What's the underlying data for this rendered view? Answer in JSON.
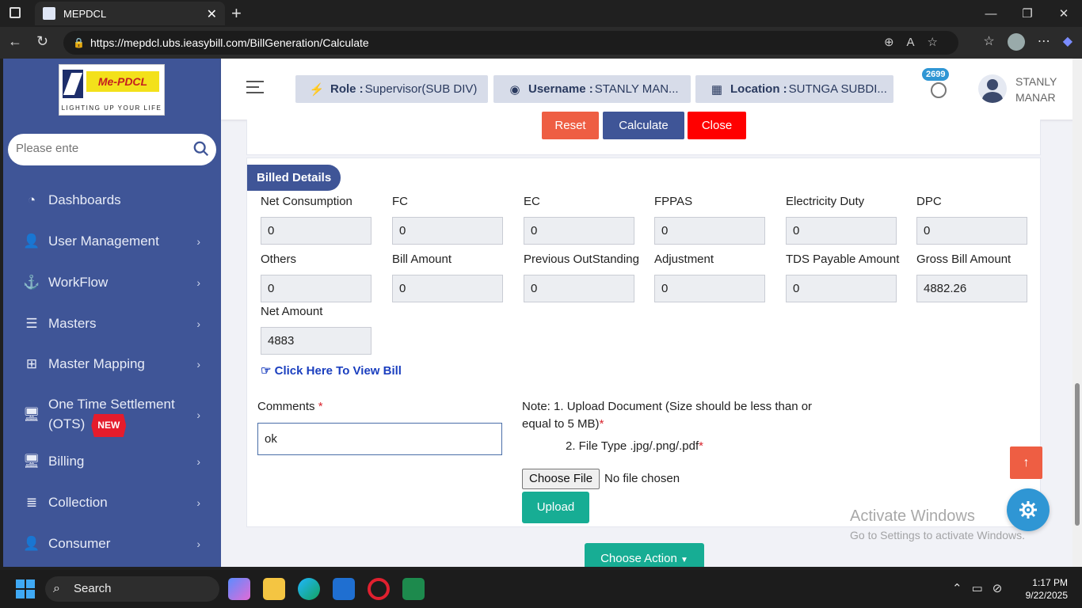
{
  "browser": {
    "tab_title": "MEPDCL",
    "url": "https://mepdcl.ubs.ieasybill.com/BillGeneration/Calculate"
  },
  "logo": {
    "brand": "Me-PDCL",
    "tagline": "LIGHTING UP YOUR LIFE"
  },
  "sidebar": {
    "search_placeholder": "Please ente",
    "items": [
      {
        "label": "Dashboards",
        "icon": "dashboard-icon",
        "has_chevron": false
      },
      {
        "label": "User Management",
        "icon": "user-icon",
        "has_chevron": true
      },
      {
        "label": "WorkFlow",
        "icon": "anchor-icon",
        "has_chevron": true
      },
      {
        "label": "Masters",
        "icon": "server-icon",
        "has_chevron": true
      },
      {
        "label": "Master Mapping",
        "icon": "sitemap-icon",
        "has_chevron": true
      },
      {
        "label": "One Time Settlement (OTS)",
        "icon": "monitor-icon",
        "has_chevron": true,
        "badge": "NEW"
      },
      {
        "label": "Billing",
        "icon": "monitor-icon",
        "has_chevron": true
      },
      {
        "label": "Collection",
        "icon": "list-icon",
        "has_chevron": true
      },
      {
        "label": "Consumer",
        "icon": "user-icon",
        "has_chevron": true
      }
    ]
  },
  "header": {
    "role_label": "Role :",
    "role_value": "Supervisor(SUB DIV)",
    "username_label": "Username :",
    "username_value": "STANLY MAN...",
    "location_label": "Location :",
    "location_value": "SUTNGA SUBDI...",
    "notification_count": "2699",
    "user_first": "STANLY",
    "user_last": "MANAR"
  },
  "actions": {
    "reset": "Reset",
    "calculate": "Calculate",
    "close": "Close"
  },
  "billed": {
    "title": "Billed Details",
    "fields": [
      {
        "label": "Net Consumption",
        "value": "0"
      },
      {
        "label": "FC",
        "value": "0"
      },
      {
        "label": "EC",
        "value": "0"
      },
      {
        "label": "FPPAS",
        "value": "0"
      },
      {
        "label": "Electricity Duty",
        "value": "0"
      },
      {
        "label": "DPC",
        "value": "0"
      },
      {
        "label": "Others",
        "value": "0"
      },
      {
        "label": "Bill Amount",
        "value": "0"
      },
      {
        "label": "Previous OutStanding",
        "value": "0"
      },
      {
        "label": "Adjustment",
        "value": "0"
      },
      {
        "label": "TDS Payable Amount",
        "value": "0"
      },
      {
        "label": "Gross Bill Amount",
        "value": "4882.26"
      },
      {
        "label": "Net Amount",
        "value": "4883"
      }
    ],
    "view_bill_link": "Click Here To View Bill"
  },
  "comments": {
    "label": "Comments",
    "required_mark": "*",
    "value": "ok"
  },
  "upload": {
    "note_line1": "Note: 1. Upload Document (Size should be less than or equal to 5 MB)",
    "note_line2": "2. File Type .jpg/.png/.pdf",
    "required_mark": "*",
    "choose_file": "Choose File",
    "no_file": "No file chosen",
    "upload_button": "Upload"
  },
  "choose_action": "Choose Action",
  "watermark": {
    "line1": "Activate Windows",
    "line2": "Go to Settings to activate Windows."
  },
  "taskbar": {
    "search": "Search",
    "time": "1:17 PM",
    "date": "9/22/2025"
  },
  "colors": {
    "sidebar": "#3f5597",
    "teal": "#17ad94",
    "reset": "#ee5e43",
    "close": "#ff0000"
  }
}
